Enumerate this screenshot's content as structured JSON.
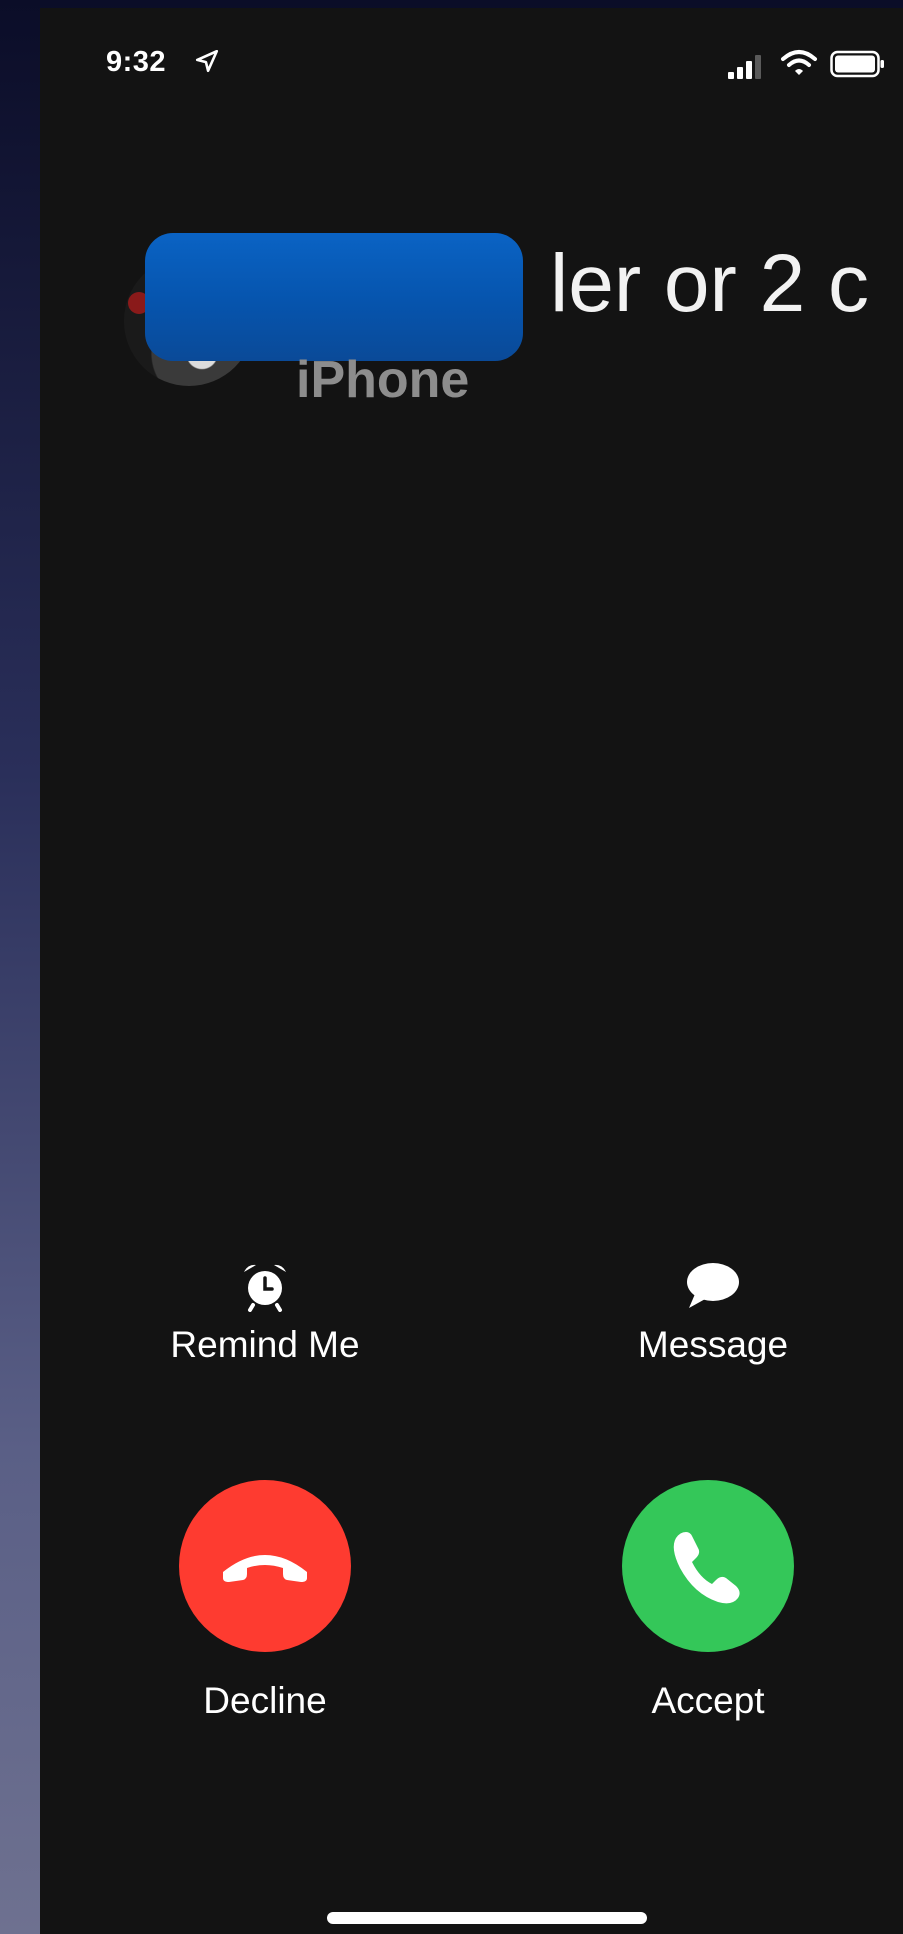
{
  "status_bar": {
    "time": "9:32",
    "icons": [
      "location-arrow-icon",
      "cellular-signal-icon",
      "wifi-icon",
      "battery-icon"
    ]
  },
  "caller": {
    "name_visible": "ler or 2 c",
    "subtitle": "iPhone",
    "redaction_color": "#0a5bb8"
  },
  "actions": {
    "remind_label": "Remind Me",
    "remind_icon": "alarm-clock-icon",
    "message_label": "Message",
    "message_icon": "speech-bubble-icon"
  },
  "call_buttons": {
    "decline_label": "Decline",
    "decline_color": "#fe3b30",
    "decline_icon": "phone-hangup-icon",
    "accept_label": "Accept",
    "accept_color": "#34c759",
    "accept_icon": "phone-icon"
  }
}
